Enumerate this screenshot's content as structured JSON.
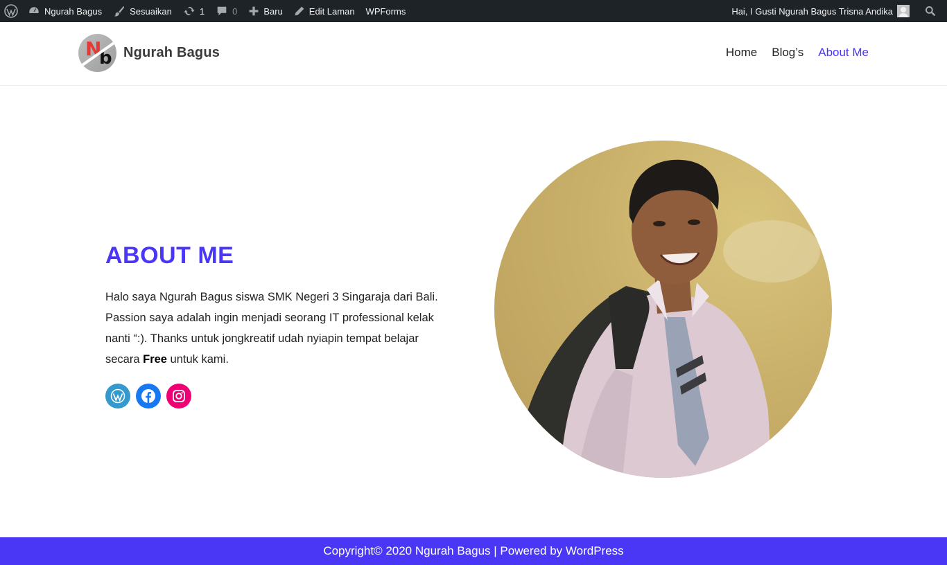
{
  "admin_bar": {
    "site_name": "Ngurah Bagus",
    "customize": "Sesuaikan",
    "updates_count": "1",
    "comments_count": "0",
    "new_label": "Baru",
    "edit_page": "Edit Laman",
    "wpforms": "WPForms",
    "greeting": "Hai, I Gusti Ngurah Bagus Trisna Andika"
  },
  "header": {
    "site_title": "Ngurah Bagus",
    "nav": [
      {
        "label": "Home",
        "active": false
      },
      {
        "label": "Blog’s",
        "active": false
      },
      {
        "label": "About Me",
        "active": true
      }
    ]
  },
  "main": {
    "title": "ABOUT ME",
    "text_before_bold": "Halo saya Ngurah Bagus siswa SMK Negeri 3 Singaraja dari Bali. Passion saya adalah ingin menjadi seorang IT professional kelak nanti “:). Thanks untuk jongkreatif udah nyiapin tempat belajar secara ",
    "text_bold": "Free",
    "text_after_bold": " untuk kami.",
    "socials": [
      "wordpress-icon",
      "facebook-icon",
      "instagram-icon"
    ]
  },
  "footer": {
    "text": "Copyright© 2020 Ngurah Bagus | Powered by WordPress"
  },
  "colors": {
    "accent": "#4a36f5",
    "adminbar": "#1d2327"
  }
}
